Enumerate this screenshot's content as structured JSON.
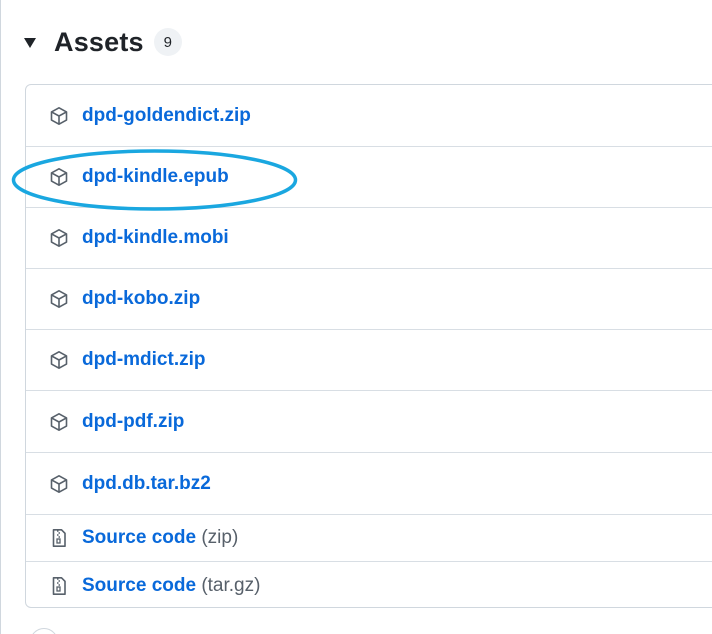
{
  "assets": {
    "title": "Assets",
    "count": "9",
    "items": [
      {
        "label": "dpd-goldendict.zip",
        "suffix": "",
        "icon": "package-icon"
      },
      {
        "label": "dpd-kindle.epub",
        "suffix": "",
        "icon": "package-icon",
        "highlighted": true
      },
      {
        "label": "dpd-kindle.mobi",
        "suffix": "",
        "icon": "package-icon"
      },
      {
        "label": "dpd-kobo.zip",
        "suffix": "",
        "icon": "package-icon"
      },
      {
        "label": "dpd-mdict.zip",
        "suffix": "",
        "icon": "package-icon"
      },
      {
        "label": "dpd-pdf.zip",
        "suffix": "",
        "icon": "package-icon"
      },
      {
        "label": "dpd.db.tar.bz2",
        "suffix": "",
        "icon": "package-icon"
      },
      {
        "label": "Source code",
        "suffix": "(zip)",
        "icon": "file-zip-icon"
      },
      {
        "label": "Source code",
        "suffix": "(tar.gz)",
        "icon": "file-zip-icon"
      }
    ]
  },
  "colors": {
    "link": "#0969da",
    "highlight": "#1aa7e0",
    "border": "#d0d7de"
  }
}
